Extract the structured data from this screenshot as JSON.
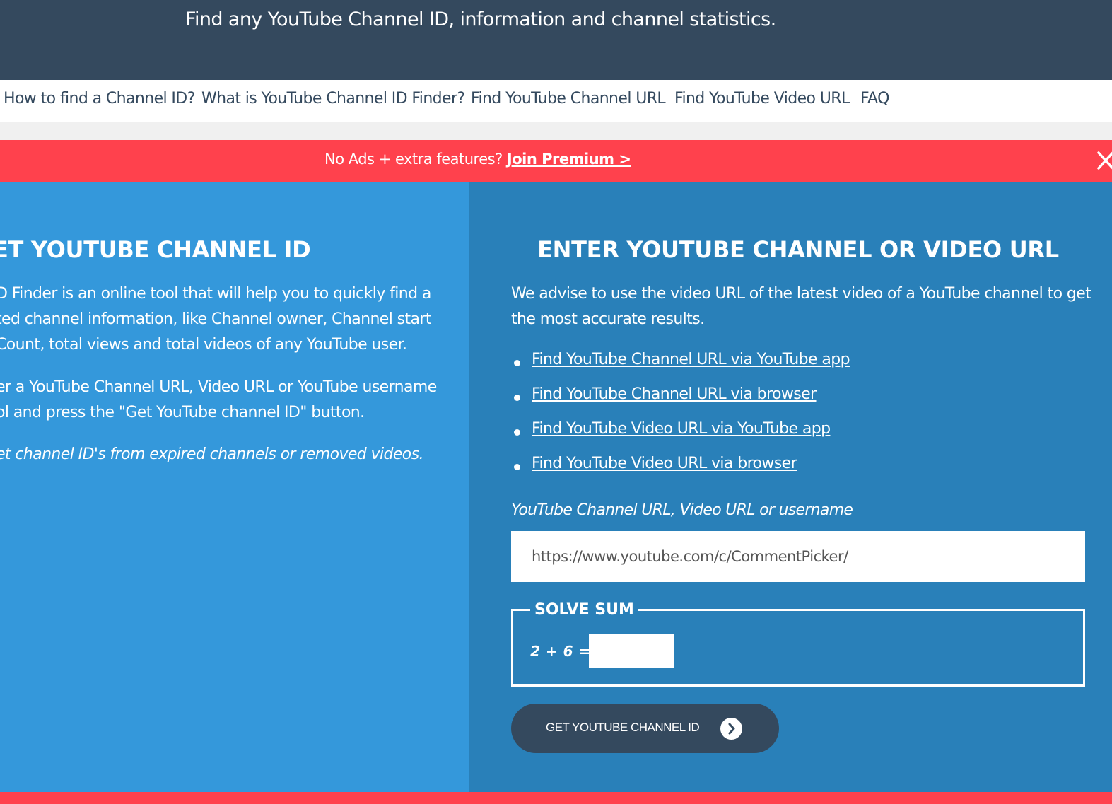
{
  "header": {
    "tagline": "Find any YouTube Channel ID, information and channel statistics."
  },
  "nav": {
    "items": [
      "How to find a Channel ID?",
      "What is YouTube Channel ID Finder?",
      "Find YouTube Channel URL",
      "Find YouTube Video URL",
      "FAQ"
    ]
  },
  "promo": {
    "text": "No Ads + extra features? ",
    "link": "Join Premium >",
    "close_icon": "close-icon"
  },
  "left": {
    "title": "GET YOUTUBE CHANNEL ID",
    "para1": [
      "D Finder is an online tool that will help you to quickly find a",
      "ted channel information, like Channel owner, Channel start",
      " Count, total views and total videos of any YouTube user."
    ],
    "para2": [
      "er a YouTube Channel URL, Video URL or YouTube username",
      "ol and press the \"Get YouTube channel ID\" button."
    ],
    "para3": "et channel ID's from expired channels or removed videos."
  },
  "right": {
    "title": "ENTER YOUTUBE CHANNEL OR VIDEO URL",
    "advise": [
      "We advise to use the video URL of the latest video of a YouTube channel to get",
      "the most accurate results."
    ],
    "links": [
      "Find YouTube Channel URL via YouTube app",
      "Find YouTube Channel URL via browser",
      "Find YouTube Video URL via YouTube app",
      "Find YouTube Video URL via browser"
    ],
    "input_label": "YouTube Channel URL, Video URL or username",
    "input_value": "https://www.youtube.com/c/CommentPicker/",
    "sum_legend": "SOLVE SUM",
    "sum_label": "2 + 6 =",
    "sum_value": "",
    "button_label": "GET YOUTUBE CHANNEL ID",
    "button_icon": "chevron-right-icon"
  },
  "colors": {
    "header_bg": "#34495e",
    "promo_bg": "#ff414d",
    "left_bg": "#3498db",
    "right_bg": "#2980b9"
  }
}
